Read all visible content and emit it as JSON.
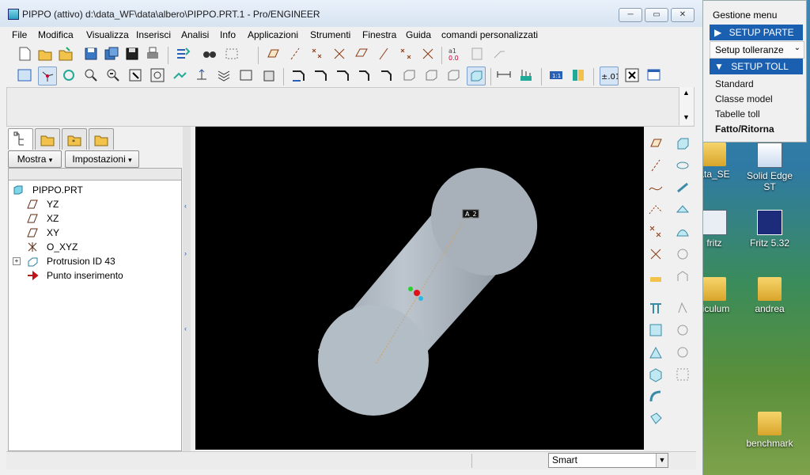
{
  "window": {
    "title": "PIPPO (attivo)  d:\\data_WF\\data\\albero\\PIPPO.PRT.1 - Pro/ENGINEER",
    "minimize": "─",
    "maximize": "▭",
    "close": "✕"
  },
  "menubar": [
    "File",
    "Modifica",
    "Visualizza",
    "Inserisci",
    "Analisi",
    "Info",
    "Applicazioni",
    "Strumenti",
    "Finestra",
    "Guida",
    "comandi personalizzati"
  ],
  "left_panel": {
    "buttons": {
      "show": "Mostra",
      "settings": "Impostazioni"
    },
    "tree": {
      "root": "PIPPO.PRT",
      "items": [
        {
          "label": "YZ",
          "icon": "datum-plane-icon"
        },
        {
          "label": "XZ",
          "icon": "datum-plane-icon"
        },
        {
          "label": "XY",
          "icon": "datum-plane-icon"
        },
        {
          "label": "O_XYZ",
          "icon": "csys-icon"
        },
        {
          "label": "Protrusion ID 43",
          "icon": "protrusion-icon",
          "expandable": true
        },
        {
          "label": "Punto inserimento",
          "icon": "insert-arrow-icon"
        }
      ]
    }
  },
  "viewport": {
    "axis_label": "A_2",
    "background": "#000000",
    "model_color": "#b3bdc6"
  },
  "statusbar": {
    "filter": "Smart"
  },
  "menu_manager": {
    "title": "Gestione menu",
    "setup_part": "SETUP PARTE",
    "tolerance_setup": "Setup tolleranze",
    "setup_toll": "SETUP TOLL",
    "items": [
      "Standard",
      "Classe model",
      "Tabelle toll",
      "Fatto/Ritorna"
    ]
  },
  "desktop": {
    "icons": [
      {
        "label": "ata_SE",
        "icon": "folder-icon"
      },
      {
        "label": "Solid Edge ST",
        "icon": "solid-edge-icon"
      },
      {
        "label": "fritz",
        "icon": "fritz-icon"
      },
      {
        "label": "Fritz 5.32",
        "icon": "fritz-icon"
      },
      {
        "label": "riculum",
        "icon": "folder-icon"
      },
      {
        "label": "andrea",
        "icon": "folder-icon"
      },
      {
        "label": "benchmark",
        "icon": "folder-icon"
      }
    ]
  },
  "colors": {
    "accent": "#1b5fb0",
    "title_gradient_top": "#e9f1fa",
    "desktop": "#2f7aa5"
  }
}
